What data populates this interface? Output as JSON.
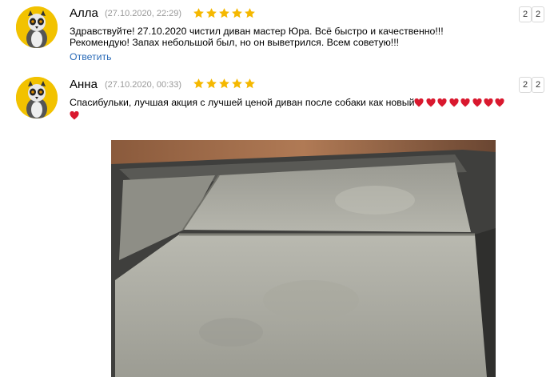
{
  "reviews": [
    {
      "name": "Алла",
      "date": "(27.10.2020, 22:29)",
      "rating": 5,
      "text_line1": "Здравствуйте! 27.10.2020 чистил диван мастер Юра. Всё быстро и качественно!!!",
      "text_line2": "Рекомендую! Запах небольшой был, но он выветрился. Всем советую!!!",
      "reply_label": "Ответить",
      "vote_a": "2",
      "vote_b": "2"
    },
    {
      "name": "Анна",
      "date": "(27.10.2020, 00:33)",
      "rating": 5,
      "text": "Спасибульки, лучшая акция с лучшей ценой диван после собаки как новый",
      "vote_a": "2",
      "vote_b": "2"
    }
  ],
  "colors": {
    "star": "#f5b800",
    "link": "#2a6bb8",
    "date": "#999999",
    "heart": "#d9182e",
    "avatar_bg": "#f2c200"
  },
  "icons": {
    "avatar": "lemur-avatar-icon",
    "star": "star-icon",
    "heart": "heart-emoji-icon"
  }
}
